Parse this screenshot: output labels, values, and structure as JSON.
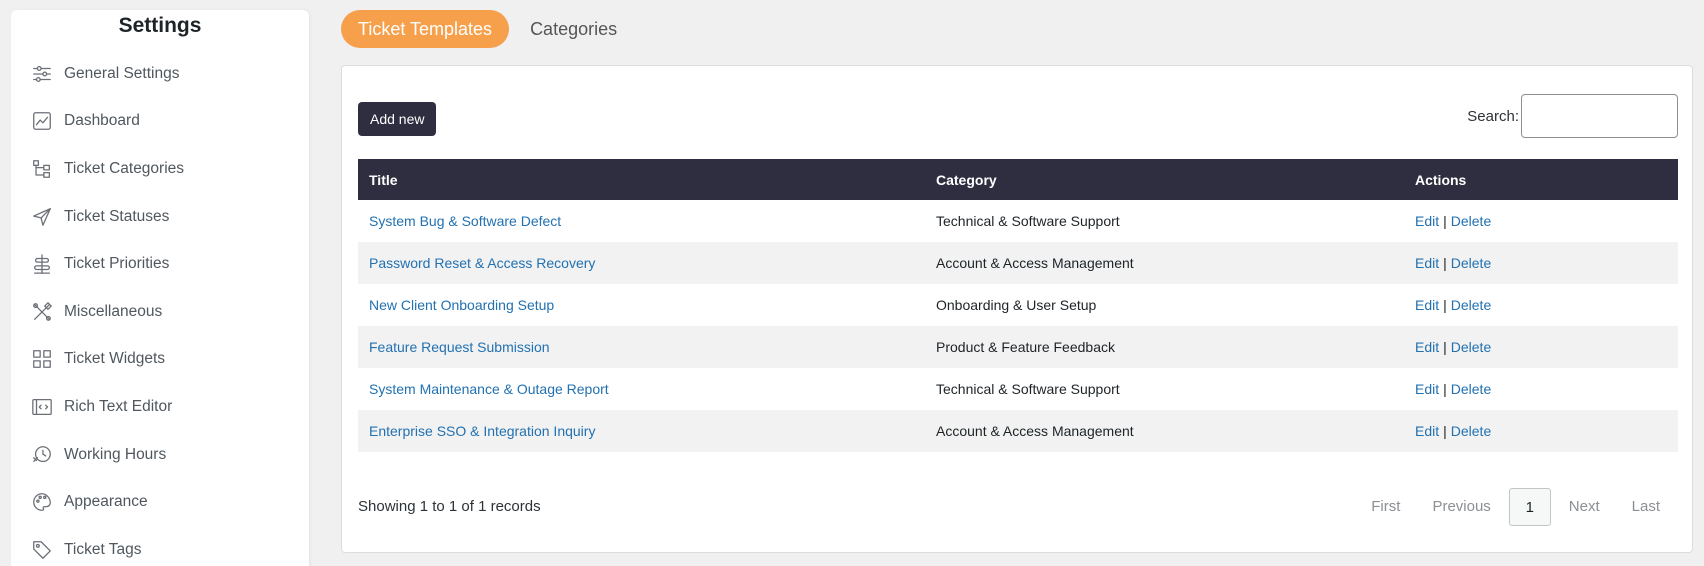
{
  "sidebar": {
    "title": "Settings",
    "items": [
      {
        "label": "General Settings",
        "icon": "sliders-icon"
      },
      {
        "label": "Dashboard",
        "icon": "chart-icon"
      },
      {
        "label": "Ticket Categories",
        "icon": "tree-icon"
      },
      {
        "label": "Ticket Statuses",
        "icon": "send-icon"
      },
      {
        "label": "Ticket Priorities",
        "icon": "priority-icon"
      },
      {
        "label": "Miscellaneous",
        "icon": "tools-icon"
      },
      {
        "label": "Ticket Widgets",
        "icon": "widgets-icon"
      },
      {
        "label": "Rich Text Editor",
        "icon": "code-icon"
      },
      {
        "label": "Working Hours",
        "icon": "clock-icon"
      },
      {
        "label": "Appearance",
        "icon": "palette-icon"
      },
      {
        "label": "Ticket Tags",
        "icon": "tag-icon"
      }
    ]
  },
  "tabs": [
    {
      "label": "Ticket Templates",
      "active": true
    },
    {
      "label": "Categories",
      "active": false
    }
  ],
  "toolbar": {
    "add_label": "Add new",
    "search_label": "Search:",
    "search_value": ""
  },
  "table": {
    "headers": [
      "Title",
      "Category",
      "Actions"
    ],
    "edit_label": "Edit",
    "separator": "|",
    "delete_label": "Delete",
    "rows": [
      {
        "title": "System Bug & Software Defect",
        "category": "Technical & Software Support"
      },
      {
        "title": "Password Reset & Access Recovery",
        "category": "Account & Access Management"
      },
      {
        "title": "New Client Onboarding Setup",
        "category": "Onboarding & User Setup"
      },
      {
        "title": "Feature Request Submission",
        "category": "Product & Feature Feedback"
      },
      {
        "title": "System Maintenance & Outage Report",
        "category": "Technical & Software Support"
      },
      {
        "title": "Enterprise SSO & Integration Inquiry",
        "category": "Account & Access Management"
      }
    ]
  },
  "footer": {
    "records_text": "Showing 1 to 1 of 1 records",
    "first": "First",
    "previous": "Previous",
    "page": "1",
    "next": "Next",
    "last": "Last"
  },
  "colors": {
    "accent": "#f6a04b",
    "header_dark": "#2e2e40",
    "link": "#2271b1"
  }
}
